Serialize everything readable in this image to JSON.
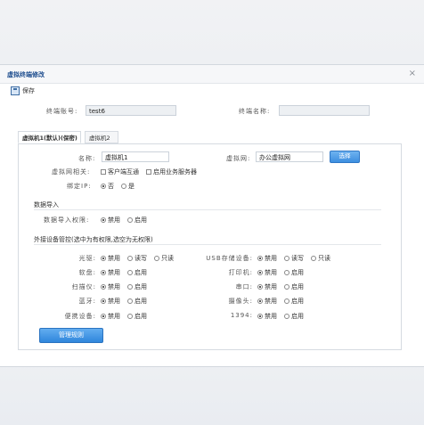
{
  "window": {
    "title": "虚拟终端修改",
    "close_glyph": "×"
  },
  "toolbar": {
    "save_label": "保存"
  },
  "header_fields": {
    "account_label": "终端账号:",
    "account_value": "test6",
    "name_label": "终端名称:",
    "name_value": ""
  },
  "tabs": [
    {
      "label": "虚拟机1(默认)(保密)",
      "active": true
    },
    {
      "label": "虚拟机2",
      "active": false
    }
  ],
  "vm": {
    "name_label": "名称:",
    "name_value": "虚拟机1",
    "network_label": "虚拟网:",
    "network_value": "办公虚拟网",
    "select_button": "选择",
    "related_label": "虚拟网相关:",
    "related_options": [
      "客户端互通",
      "启用业务服务器"
    ],
    "bind_ip_label": "绑定IP:",
    "bind_ip_options": [
      "否",
      "是"
    ],
    "bind_ip_selected": "否"
  },
  "data_import": {
    "section_title": "数据导入",
    "perm_label": "数据导入权限:",
    "options": [
      "禁用",
      "启用"
    ],
    "selected": "禁用"
  },
  "devices": {
    "section_title": "外接设备管控(选中为有权限,选空为无权限)",
    "left": [
      {
        "label": "光驱:",
        "options": [
          "禁用",
          "读写",
          "只读"
        ],
        "selected": "禁用"
      },
      {
        "label": "软盘:",
        "options": [
          "禁用",
          "启用"
        ],
        "selected": "禁用"
      },
      {
        "label": "扫描仪:",
        "options": [
          "禁用",
          "启用"
        ],
        "selected": "禁用"
      },
      {
        "label": "蓝牙:",
        "options": [
          "禁用",
          "启用"
        ],
        "selected": "禁用"
      },
      {
        "label": "便携设备:",
        "options": [
          "禁用",
          "启用"
        ],
        "selected": "禁用"
      }
    ],
    "right": [
      {
        "label": "USB存储设备:",
        "options": [
          "禁用",
          "读写",
          "只读"
        ],
        "selected": "禁用"
      },
      {
        "label": "打印机:",
        "options": [
          "禁用",
          "启用"
        ],
        "selected": "禁用"
      },
      {
        "label": "串口:",
        "options": [
          "禁用",
          "启用"
        ],
        "selected": "禁用"
      },
      {
        "label": "摄像头:",
        "options": [
          "禁用",
          "启用"
        ],
        "selected": "禁用"
      },
      {
        "label": "1394:",
        "options": [
          "禁用",
          "启用"
        ],
        "selected": "禁用"
      }
    ]
  },
  "footer": {
    "rules_button": "管理规则"
  }
}
